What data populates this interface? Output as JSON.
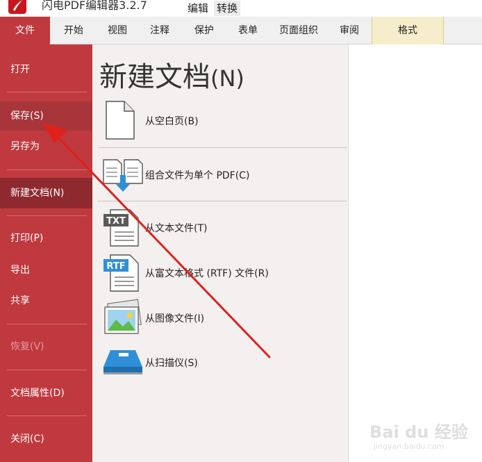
{
  "app": {
    "title": "闪电PDF编辑器3.2.7",
    "context_tabs": [
      "编辑",
      "转换"
    ]
  },
  "menu": {
    "file": "文件",
    "items": [
      "开始",
      "视图",
      "注释",
      "保护",
      "表单",
      "页面组织",
      "审阅"
    ],
    "format": "格式"
  },
  "sidebar": {
    "open": "打开",
    "save": "保存(S)",
    "save_as": "另存为",
    "new_doc": "新建文档(N)",
    "print": "打印(P)",
    "export": "导出",
    "share": "共享",
    "restore": "恢复(V)",
    "properties": "文档属性(D)",
    "close": "关闭(C)"
  },
  "panel": {
    "title": "新建文档",
    "title_mnemonic": "(N)",
    "options": {
      "blank": "从空白页(B)",
      "combine": "组合文件为单个 PDF(C)",
      "text": "从文本文件(T)",
      "rtf": "从富文本格式 (RTF) 文件(R)",
      "image": "从图像文件(I)",
      "scanner": "从扫描仪(S)"
    },
    "icon_text": {
      "txt": "TXT",
      "rtf": "RTF"
    }
  },
  "watermark": {
    "brand": "Bai du 经验",
    "sub": "jingyan.baidu.com"
  },
  "colors": {
    "sidebar": "#c0393f",
    "sidebar_selected": "#8e2a2f",
    "format_tab": "#f6eecb",
    "arrow": "#e0201c"
  }
}
